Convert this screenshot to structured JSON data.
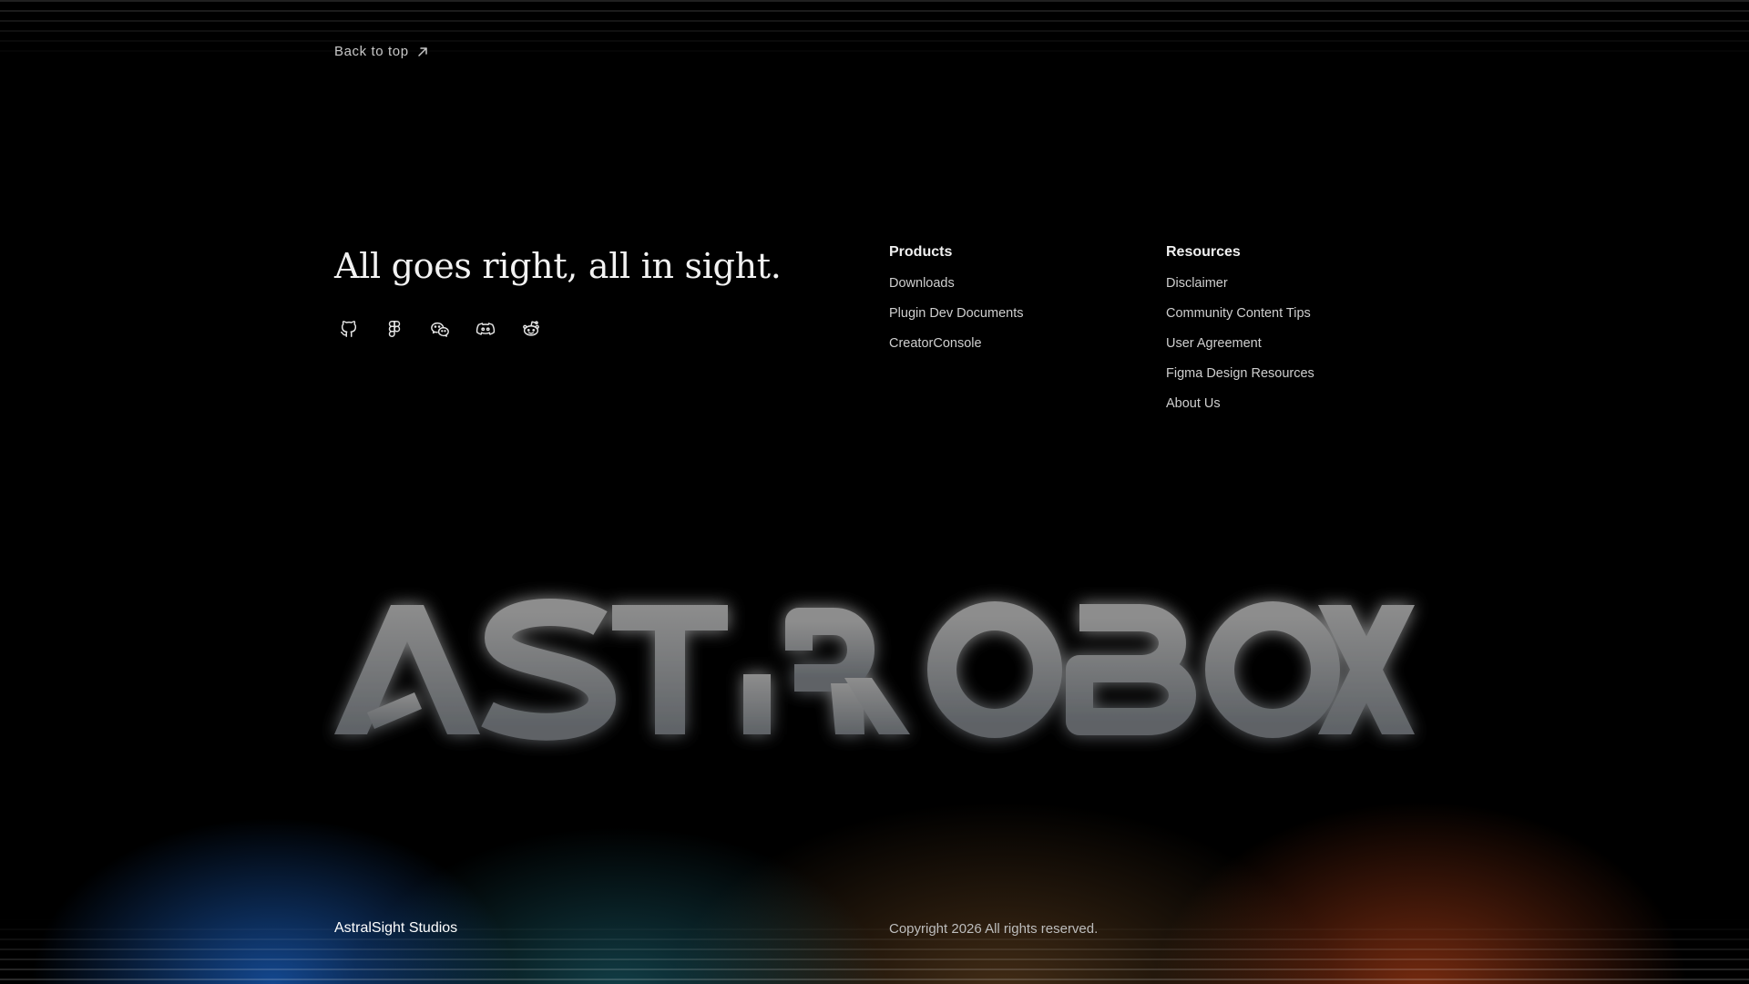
{
  "back_to_top": {
    "label": "Back to top",
    "icon": "arrow-up-right-icon"
  },
  "hero": {
    "tagline": "All goes right, all in sight."
  },
  "socials": [
    {
      "name": "github",
      "icon": "github-icon"
    },
    {
      "name": "figma",
      "icon": "figma-icon"
    },
    {
      "name": "wechat",
      "icon": "wechat-icon"
    },
    {
      "name": "discord",
      "icon": "discord-icon"
    },
    {
      "name": "reddit",
      "icon": "reddit-icon"
    }
  ],
  "products": {
    "title": "Products",
    "links": [
      "Downloads",
      "Plugin Dev Documents",
      "CreatorConsole"
    ]
  },
  "resources": {
    "title": "Resources",
    "links": [
      "Disclaimer",
      "Community Content Tips",
      "User Agreement",
      "Figma Design Resources",
      "About Us"
    ]
  },
  "wordmark": {
    "text": "ASTROBOX"
  },
  "footer": {
    "brand": "AstralSight Studios",
    "copyright": "Copyright 2026 All rights reserved."
  },
  "colors": {
    "background": "#000000",
    "glow_blue": "#1e6edc",
    "glow_teal": "#288ca0",
    "glow_orange": "#dc501e"
  }
}
